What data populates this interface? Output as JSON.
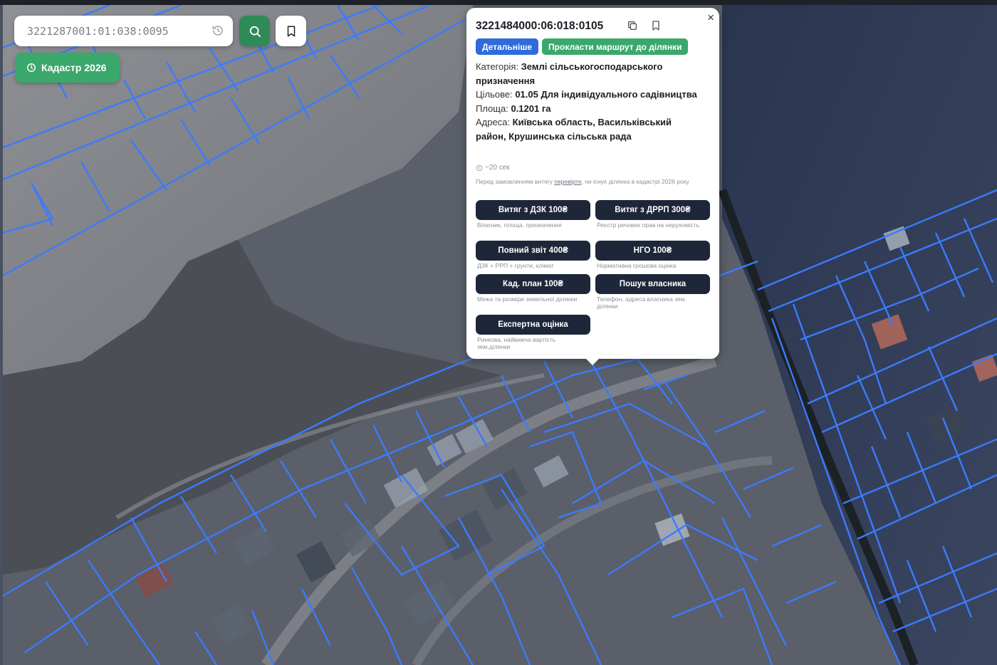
{
  "search": {
    "value": "3221287001:01:038:0095",
    "search_button_icon": "search-icon",
    "history_icon": "history-icon",
    "bookmark_icon": "bookmark-icon"
  },
  "cadastre_button": {
    "label": "Кадастр 2026",
    "icon": "clock-icon"
  },
  "popup": {
    "parcel_number": "3221484000:06:018:0105",
    "copy_icon": "copy-icon",
    "bookmark_icon": "bookmark-icon",
    "close_label": "×",
    "details_label": "Детальніше",
    "route_label": "Прокласти маршрут до ділянки",
    "category_label": "Категорія: ",
    "category_value": "Землі сільськогосподарського призначення",
    "purpose_label": "Цільове: ",
    "purpose_value": "01.05 Для індивідуального садівництва",
    "area_label": "Площа: ",
    "area_value": "0.1201 га",
    "address_label": "Адреса: ",
    "address_value": "Київська область, Васильківський район, Крушинська сільська рада",
    "time_estimate": "~20 сек",
    "note_before": "Перед замовленням витягу ",
    "note_link": "перевірте",
    "note_after": ", чи існує ділянка в кадастрі 2026 року",
    "orders": [
      {
        "label": "Витяг з ДЗК 100₴",
        "desc": "Власник, площа, призначення"
      },
      {
        "label": "Витяг з ДРРП 300₴",
        "desc": "Реєстр речових прав на нерухомість"
      },
      {
        "label": "Повний звіт 400₴",
        "desc": "ДЗК + РРП + грунти, клімат"
      },
      {
        "label": "НГО 100₴",
        "desc": "Нормативна грошова оцінка"
      },
      {
        "label": "Кад. план 100₴",
        "desc": "Межа та розміри земельної ділянки"
      },
      {
        "label": "Пошук власника",
        "desc": "Телефон, адреса власника зем. ділянки"
      },
      {
        "label": "Експертна оцінка",
        "desc": "Ринкова, найвижча вартість зем.ділянки"
      }
    ]
  },
  "colors": {
    "parcel_line": "#3b7bff",
    "accent_green": "#3aa86b",
    "accent_blue": "#2f6bdc",
    "order_button": "#1e2739"
  }
}
